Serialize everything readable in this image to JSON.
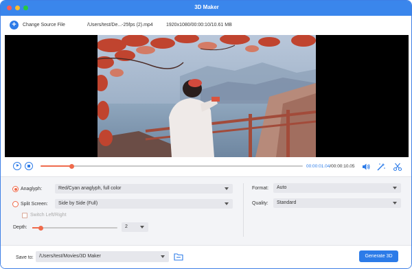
{
  "window": {
    "title": "3D Maker"
  },
  "toolbar": {
    "change_source_label": "Change Source File",
    "file_path": "/Users/test/De...-25fps (2).mp4",
    "file_info": "1920x1080/00:00:10/10.61 MB"
  },
  "playback": {
    "current_time": "00:00:01.04",
    "separator": "/",
    "total_time": "00:00:10.05",
    "progress_fraction": 0.12
  },
  "settings": {
    "anaglyph": {
      "label": "Anaglyph:",
      "selected": true,
      "value": "Red/Cyan anaglyph, full color"
    },
    "split_screen": {
      "label": "Split Screen:",
      "selected": false,
      "value": "Side by Side (Full)"
    },
    "switch_left_right": {
      "label": "Switch Left/Right",
      "checked": false
    },
    "depth": {
      "label": "Depth:",
      "value": "2",
      "slider_fraction": 0.1
    },
    "format": {
      "label": "Format:",
      "value": "Auto"
    },
    "quality": {
      "label": "Quality:",
      "value": "Standard"
    }
  },
  "footer": {
    "save_label": "Save to:",
    "save_path": "/Users/test/Movies/3D Maker",
    "generate_label": "Generate 3D"
  },
  "colors": {
    "accent": "#2c7be8",
    "highlight": "#ef6a4b",
    "titlebar": "#3a86ec"
  }
}
